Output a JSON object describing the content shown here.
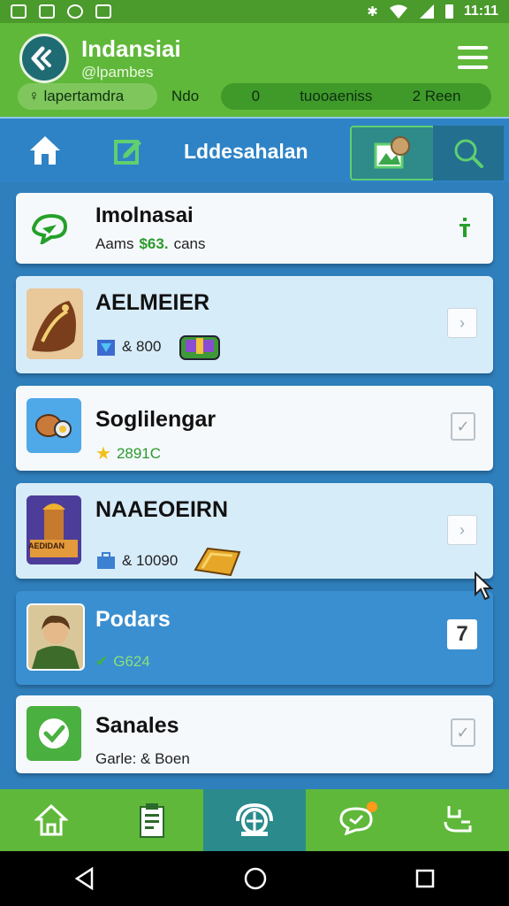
{
  "status_bar": {
    "time": "11:11"
  },
  "header": {
    "title": "Indansiai",
    "handle": "@lpambes",
    "user_chip": "♀ lapertamdra",
    "mode_label": "Ndo",
    "stats_count": "0",
    "stats_label": "tuooaeniss",
    "stats_extra": "2 Reen"
  },
  "nav": {
    "title": "Lddesahalan"
  },
  "cards": [
    {
      "title": "Imolnasai",
      "sub_prefix": "Aams",
      "sub_value": "$63.",
      "sub_suffix": "cans"
    },
    {
      "title": "AELMEIER",
      "sub": "& 800"
    },
    {
      "title": "Soglilengar",
      "sub": "2891C"
    },
    {
      "title": "NAAEOEIRN",
      "sub": "& 10090",
      "thumb_text": "AEDIDAN"
    },
    {
      "title": "Podars",
      "sub": "G624",
      "box_label": "7"
    },
    {
      "title": "Sanales",
      "sub": "Garle: & Boen"
    }
  ],
  "icons": [
    "back-arrow-icon",
    "menu-icon",
    "home-icon",
    "edit-icon",
    "gallery-icon",
    "search-icon",
    "chat-bubble-icon",
    "info-icon",
    "chevron-right-icon",
    "checkbox-icon",
    "tab-home-icon",
    "tab-list-icon",
    "tab-globe-icon",
    "tab-chat-icon",
    "tab-profile-icon",
    "sys-back-icon",
    "sys-home-icon",
    "sys-recents-icon"
  ],
  "colors": {
    "primary_green": "#5fb83a",
    "primary_blue": "#2e83c6",
    "accent_teal": "#2a8a8c"
  }
}
